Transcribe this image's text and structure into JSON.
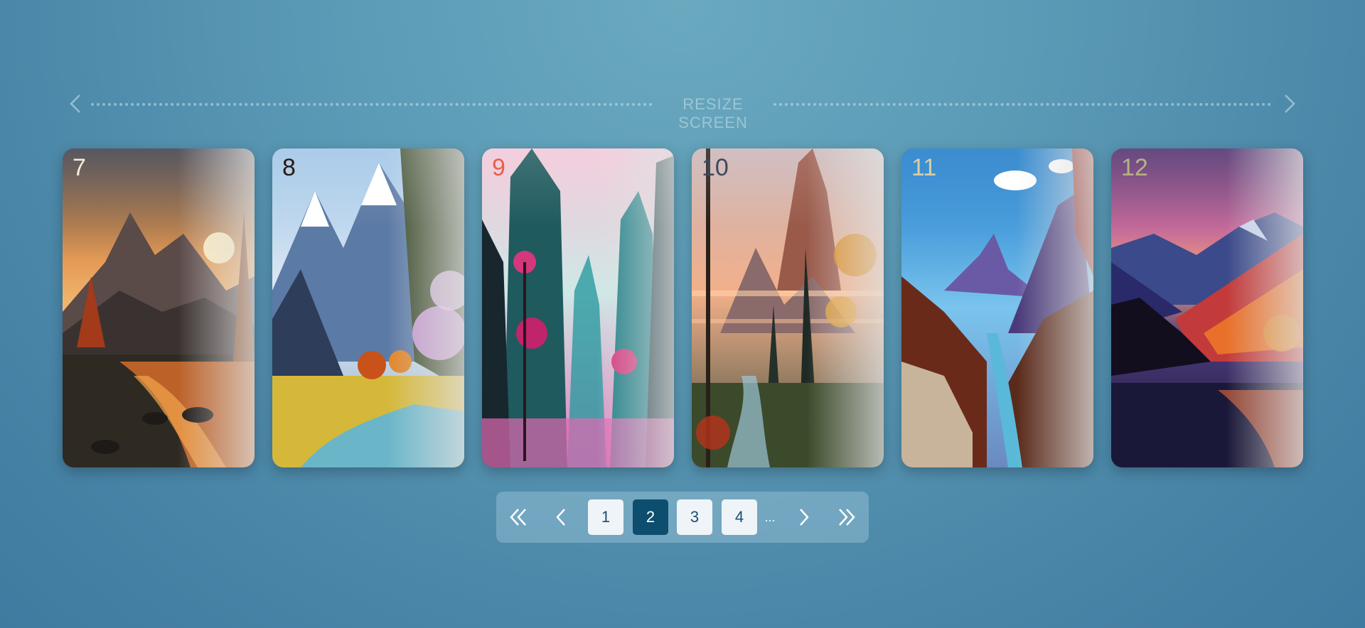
{
  "header": {
    "label": "RESIZE SCREEN",
    "prev_icon": "chevron-left-icon",
    "next_icon": "chevron-right-icon"
  },
  "cards": [
    {
      "number": "7",
      "number_color": "#f3ead8"
    },
    {
      "number": "8",
      "number_color": "#2a1a10"
    },
    {
      "number": "9",
      "number_color": "#e8604a"
    },
    {
      "number": "10",
      "number_color": "#3c4a5a"
    },
    {
      "number": "11",
      "number_color": "#d7cfa6"
    },
    {
      "number": "12",
      "number_color": "#b5b283"
    }
  ],
  "pagination": {
    "first_icon": "double-chevron-left-icon",
    "prev_icon": "chevron-left-icon",
    "pages": [
      "1",
      "2",
      "3",
      "4"
    ],
    "active_page": "2",
    "ellipsis": "...",
    "next_icon": "chevron-right-icon",
    "last_icon": "double-chevron-right-icon"
  },
  "colors": {
    "active_page": "#0d4e6f",
    "page_button": "#eef4f7",
    "page_text": "#1d4e70"
  }
}
